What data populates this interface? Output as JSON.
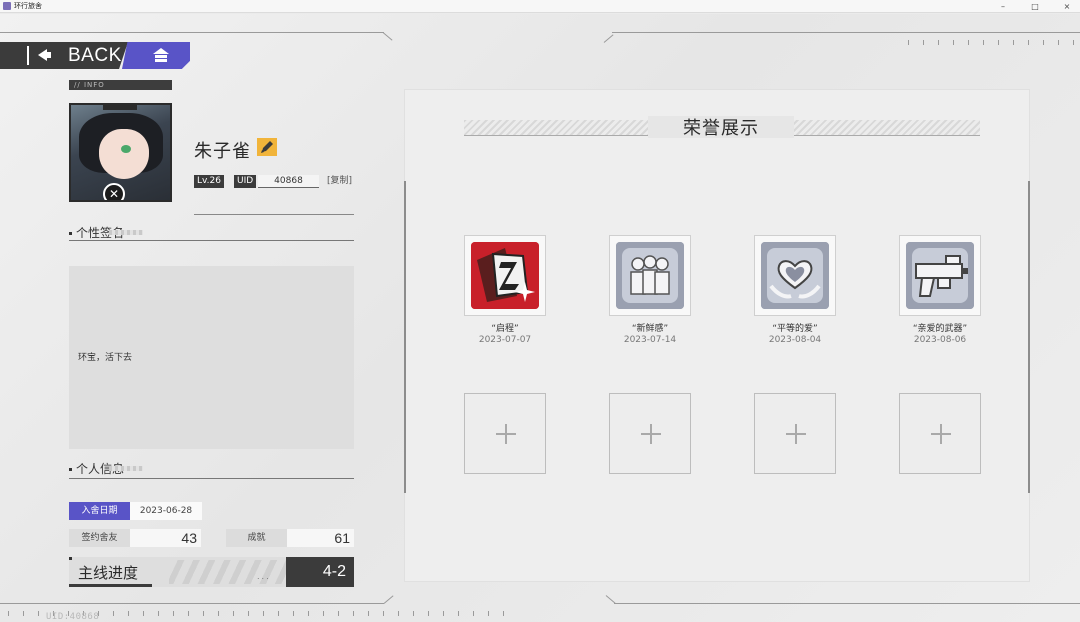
{
  "window": {
    "title": "环行旅舍",
    "controls": [
      "–",
      "□",
      "×"
    ]
  },
  "nav": {
    "back_label": "BACK",
    "back_icon": "arrow-left-icon",
    "home_icon": "home-icon"
  },
  "profile": {
    "info_tag": "// INFO",
    "nickname": "朱子雀",
    "level": "Lv.26",
    "uid_label": "UID",
    "uid_value": "40868",
    "copy_label": "[复制]"
  },
  "signature": {
    "title": "个性签名",
    "text": "环宝，活下去"
  },
  "personal_info": {
    "title": "个人信息",
    "join_date_label": "入舍日期",
    "join_date_value": "2023-06-28",
    "friends_label": "签约舍友",
    "friends_value": "43",
    "achievements_label": "成就",
    "achievements_value": "61",
    "progress_label": "主线进度",
    "progress_dots": "...",
    "progress_value": "4-2",
    "progress_fraction": 0.29
  },
  "honors": {
    "title": "荣誉展示",
    "medals": [
      {
        "name": "“启程”",
        "date": "2023-07-07",
        "icon": "launch-medal-icon",
        "color": "#c8202a"
      },
      {
        "name": "“新鲜感”",
        "date": "2023-07-14",
        "icon": "group-medal-icon",
        "color": "#8f96a8"
      },
      {
        "name": "“平等的爱”",
        "date": "2023-08-04",
        "icon": "heart-medal-icon",
        "color": "#8f96a8"
      },
      {
        "name": "“亲爱的武器”",
        "date": "2023-08-06",
        "icon": "weapon-medal-icon",
        "color": "#8f96a8"
      }
    ],
    "empty_slot_icon": "plus-icon"
  },
  "footer": {
    "uid_text": "UID:40868"
  },
  "colors": {
    "accent": "#5954c7",
    "dark": "#3b3b3b",
    "edit": "#f1b43a"
  }
}
